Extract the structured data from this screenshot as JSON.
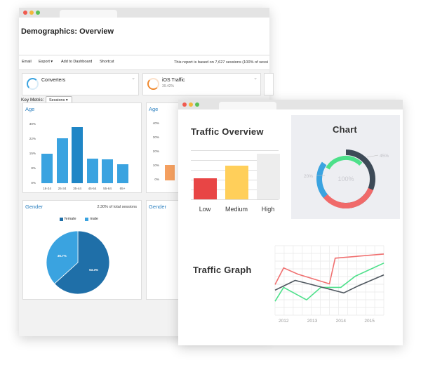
{
  "back_window": {
    "title": "Demographics: Overview",
    "toolbar": {
      "email": "Email",
      "export": "Export ▾",
      "add_dashboard": "Add to Dashboard",
      "shortcut": "Shortcut",
      "report_text": "This report is based on 7,627 sessions (100% of sessi"
    },
    "tiles": [
      {
        "name": "Converters",
        "value": "",
        "color": "#3aa3e0"
      },
      {
        "name": "iOS Traffic",
        "value": "39.42%",
        "color": "#f08a30"
      }
    ],
    "key_metric": {
      "label": "Key Metric:",
      "selected": "Sessions ▾"
    },
    "age_card": {
      "title": "Age",
      "y_ticks": [
        "30%",
        "22%",
        "15%",
        "8%",
        "0%"
      ],
      "categories": [
        "18-24",
        "25-34",
        "35-44",
        "45-54",
        "55-64",
        "65+"
      ]
    },
    "age_card2": {
      "title": "Age",
      "y_ticks": [
        "40%",
        "30%",
        "20%",
        "10%",
        "0%"
      ]
    },
    "gender_card": {
      "title": "Gender",
      "note": "2.30% of total sessions",
      "legend": [
        {
          "label": "female",
          "color": "#1f6fa8"
        },
        {
          "label": "male",
          "color": "#3aa3e0"
        }
      ],
      "slice_labels": [
        "36.7%",
        "63.3%"
      ]
    },
    "gender_card2": {
      "title": "Gender"
    }
  },
  "front_window": {
    "traffic_overview": {
      "title": "Traffic Overview",
      "categories": [
        "Low",
        "Medium",
        "High"
      ]
    },
    "chart_panel": {
      "title": "Chart",
      "labels": {
        "center": "100%",
        "right": "45%",
        "left": "20%"
      }
    },
    "traffic_graph": {
      "title": "Traffic Graph",
      "years": [
        "2012",
        "2013",
        "2014",
        "2015"
      ]
    }
  },
  "chart_data": [
    {
      "type": "bar",
      "title": "Age",
      "categories": [
        "18-24",
        "25-34",
        "35-44",
        "45-54",
        "55-64",
        "65+"
      ],
      "values": [
        15,
        23,
        28.5,
        12.5,
        12,
        9.5
      ],
      "ylim": [
        0,
        30
      ],
      "y_ticks": [
        "30%",
        "22%",
        "15%",
        "8%",
        "0%"
      ]
    },
    {
      "type": "pie",
      "title": "Gender",
      "categories": [
        "female",
        "male"
      ],
      "values": [
        63.3,
        36.7
      ]
    },
    {
      "type": "bar",
      "title": "Traffic Overview",
      "categories": [
        "Low",
        "Medium",
        "High"
      ],
      "values": [
        30,
        48,
        65
      ],
      "colors": [
        "#e84545",
        "#ffcf5a",
        "#ededed"
      ],
      "ylim": [
        0,
        70
      ]
    },
    {
      "type": "line",
      "title": "Traffic Graph",
      "x": [
        "2012",
        "2013",
        "2014",
        "2015"
      ],
      "series": [
        {
          "color": "#f07070",
          "points": [
            [
              2011.7,
              44
            ],
            [
              2012.0,
              68
            ],
            [
              2012.5,
              59
            ],
            [
              2013.6,
              45
            ],
            [
              2013.8,
              82
            ],
            [
              2015.5,
              88
            ]
          ]
        },
        {
          "color": "#4de08a",
          "points": [
            [
              2011.7,
              20
            ],
            [
              2012.0,
              40
            ],
            [
              2012.8,
              22
            ],
            [
              2013.3,
              40
            ],
            [
              2014.0,
              40
            ],
            [
              2014.5,
              56
            ],
            [
              2015.5,
              75
            ]
          ]
        },
        {
          "color": "#505860",
          "points": [
            [
              2011.7,
              36
            ],
            [
              2012.4,
              50
            ],
            [
              2012.8,
              46
            ],
            [
              2014.1,
              32
            ],
            [
              2014.6,
              42
            ],
            [
              2015.5,
              58
            ]
          ]
        }
      ],
      "ylim": [
        0,
        100
      ]
    }
  ]
}
